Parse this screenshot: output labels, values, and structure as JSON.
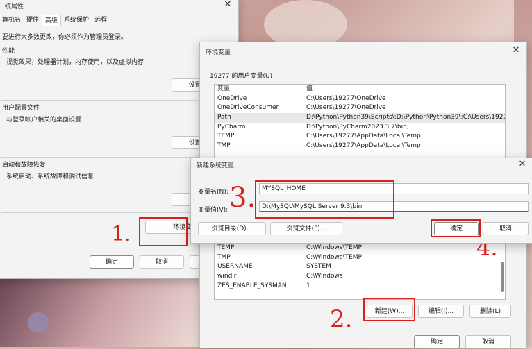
{
  "sysprops": {
    "title": "统属性",
    "tabs": [
      "算机名",
      "硬件",
      "高级",
      "系统保护",
      "远程"
    ],
    "admin_note": "要进行大多数更改，你必须作为管理员登录。",
    "performance": {
      "heading": "性能",
      "desc": "视觉效果，处理器计划，内存使用，以及虚拟内存",
      "button": "设置(S)"
    },
    "profile": {
      "heading": "用户配置文件",
      "desc": "与登录帐户相关的桌面设置",
      "button": "设置(E)"
    },
    "startup": {
      "heading": "启动和故障恢复",
      "desc": "系统启动、系统故障和调试信息",
      "button": "设置"
    },
    "env_button": "环境变量(",
    "ok": "确定",
    "cancel": "取消"
  },
  "envvars": {
    "title": "环境变量",
    "user_group": "19277 的用户变量(U)",
    "columns": {
      "name": "变量",
      "value": "值"
    },
    "user_vars": [
      {
        "name": "OneDrive",
        "value": "C:\\Users\\19277\\OneDrive"
      },
      {
        "name": "OneDriveConsumer",
        "value": "C:\\Users\\19277\\OneDrive"
      },
      {
        "name": "Path",
        "value": "D:\\Python\\Python39\\Scripts\\;D:\\Python\\Python39\\;C:\\Users\\19277..."
      },
      {
        "name": "PyCharm",
        "value": "D:\\Python\\PyCharm2023.3.7\\bin;"
      },
      {
        "name": "TEMP",
        "value": "C:\\Users\\19277\\AppData\\Local\\Temp"
      },
      {
        "name": "TMP",
        "value": "C:\\Users\\19277\\AppData\\Local\\Temp"
      }
    ],
    "system_vars": [
      {
        "name": "TEMP",
        "value": "C:\\Windows\\TEMP"
      },
      {
        "name": "TMP",
        "value": "C:\\Windows\\TEMP"
      },
      {
        "name": "USERNAME",
        "value": "SYSTEM"
      },
      {
        "name": "windir",
        "value": "C:\\Windows"
      },
      {
        "name": "ZES_ENABLE_SYSMAN",
        "value": "1"
      }
    ],
    "new_button": "新建(W)...",
    "edit_button": "编辑(I)...",
    "delete_button": "删除(L)",
    "ok": "确定",
    "cancel": "取消"
  },
  "newvar": {
    "title": "新建系统变量",
    "name_label": "变量名(N):",
    "name_value": "MYSQL_HOME",
    "value_label": "变量值(V):",
    "value_value": "D:\\MySQL\\MySQL Server 9.3\\bin",
    "browse_dir": "浏览目录(D)...",
    "browse_file": "浏览文件(F)...",
    "ok": "确定",
    "cancel": "取消"
  },
  "annotations": [
    "1.",
    "2.",
    "3.",
    "4."
  ],
  "icons": {
    "close": "close-icon"
  },
  "colors": {
    "highlight": "#d8201c",
    "focus": "#2a67c7"
  }
}
